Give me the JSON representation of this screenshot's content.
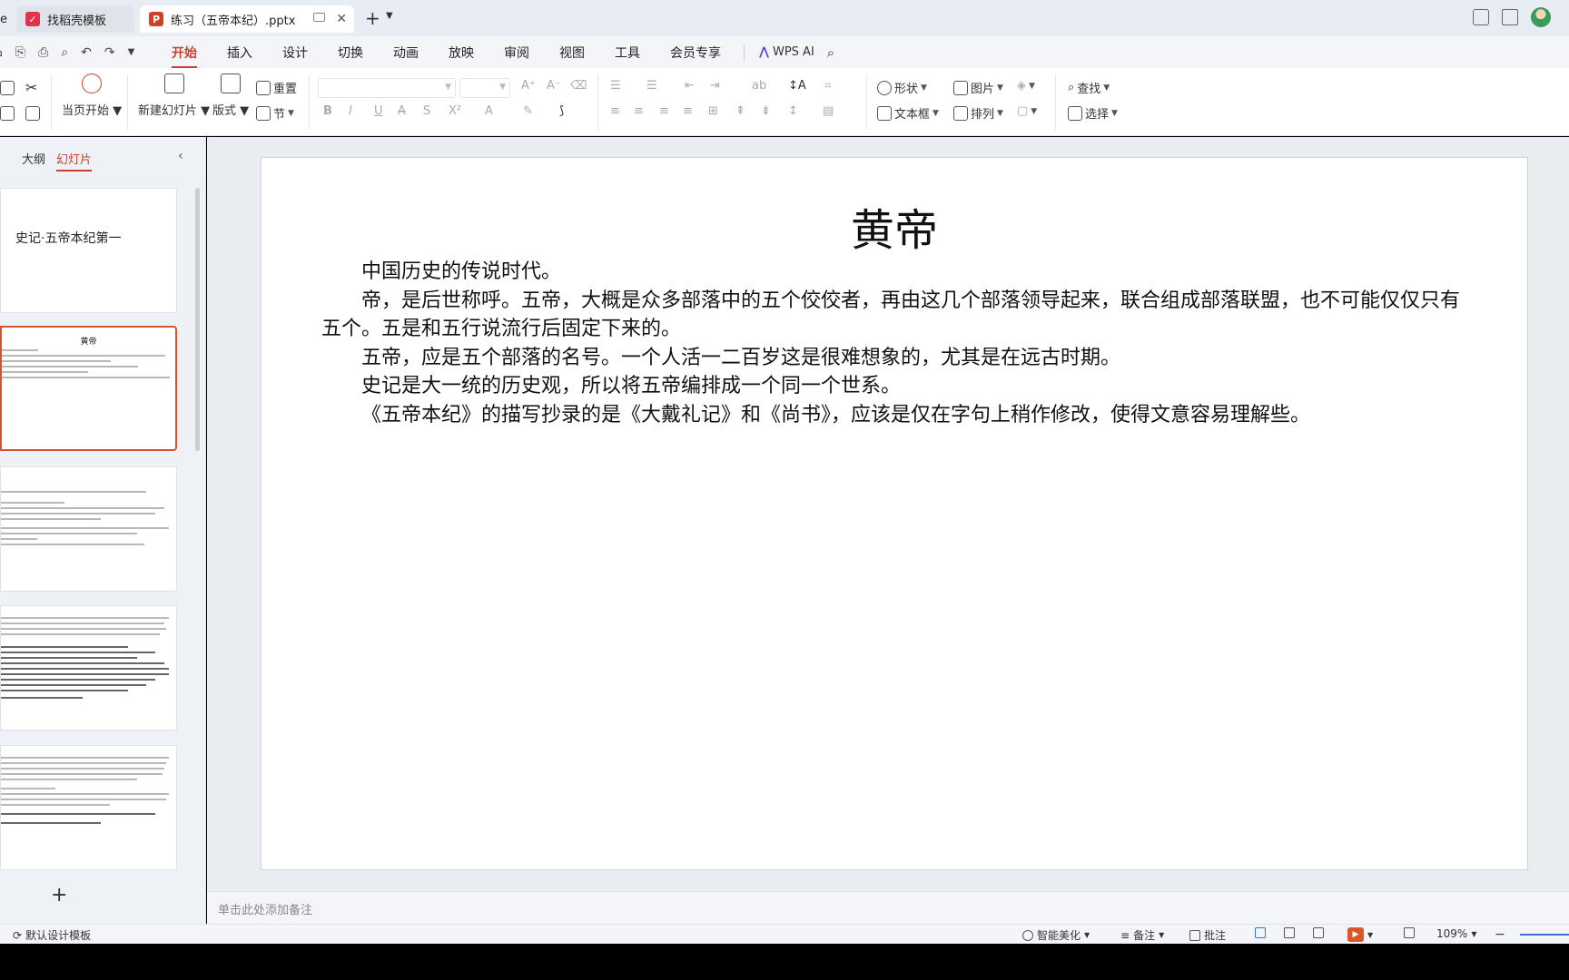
{
  "tabs": [
    {
      "label": "e",
      "logo": ""
    },
    {
      "label": "找稻壳模板",
      "logo": "docer-icon"
    },
    {
      "label": "练习（五帝本纪）.pptx",
      "logo": "P"
    }
  ],
  "menu": [
    "开始",
    "插入",
    "设计",
    "切换",
    "动画",
    "放映",
    "审阅",
    "视图",
    "工具",
    "会员专享"
  ],
  "wps_ai": "WPS AI",
  "ribbon": {
    "current_start": "当页开始",
    "new_slide": "新建幻灯片",
    "layout": "版式",
    "reset": "重置",
    "section": "节",
    "shape": "形状",
    "picture": "图片",
    "textbox": "文本框",
    "arrange": "排列",
    "find": "查找",
    "select": "选择"
  },
  "left_panel": {
    "tab_outline": "大纲",
    "tab_slides": "幻灯片",
    "slide1_title": "史记·五帝本纪第一",
    "slide2_title": "黄帝",
    "add": "+"
  },
  "slide": {
    "title": "黄帝",
    "paragraphs": [
      "中国历史的传说时代。",
      "帝，是后世称呼。五帝，大概是众多部落中的五个佼佼者，再由这几个部落领导起来，联合组成部落联盟，也不可能仅仅只有五个。五是和五行说流行后固定下来的。",
      "五帝，应是五个部落的名号。一个人活一二百岁这是很难想象的，尤其是在远古时期。",
      "史记是大一统的历史观，所以将五帝编排成一个同一个世系。",
      "《五帝本纪》的描写抄录的是《大戴礼记》和《尚书》，应该是仅在字句上稍作修改，使得文意容易理解些。"
    ]
  },
  "notes_placeholder": "单击此处添加备注",
  "status": {
    "template": "默认设计模板",
    "beautify": "智能美化",
    "notes": "备注",
    "comments": "批注",
    "zoom": "109%"
  },
  "colors": {
    "accent": "#c9412a",
    "slide_bg": "#ffffff"
  }
}
